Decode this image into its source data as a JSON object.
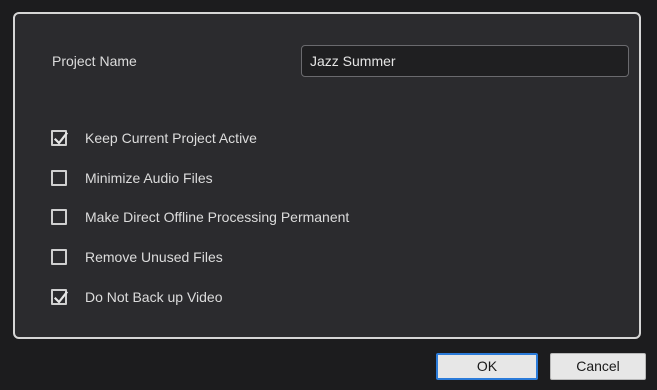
{
  "project_name": {
    "label": "Project Name",
    "value": "Jazz Summer"
  },
  "options": [
    {
      "label": "Keep Current Project Active",
      "checked": true
    },
    {
      "label": "Minimize Audio Files",
      "checked": false
    },
    {
      "label": "Make Direct Offline Processing Permanent",
      "checked": false
    },
    {
      "label": "Remove Unused Files",
      "checked": false
    },
    {
      "label": "Do Not Back up Video",
      "checked": true
    }
  ],
  "buttons": {
    "ok": "OK",
    "cancel": "Cancel"
  },
  "colors": {
    "background": "#1c1c1e",
    "panel": "#2b2b2e",
    "panel_border": "#d6d6d6",
    "ok_focus_border": "#2b7bd9"
  }
}
